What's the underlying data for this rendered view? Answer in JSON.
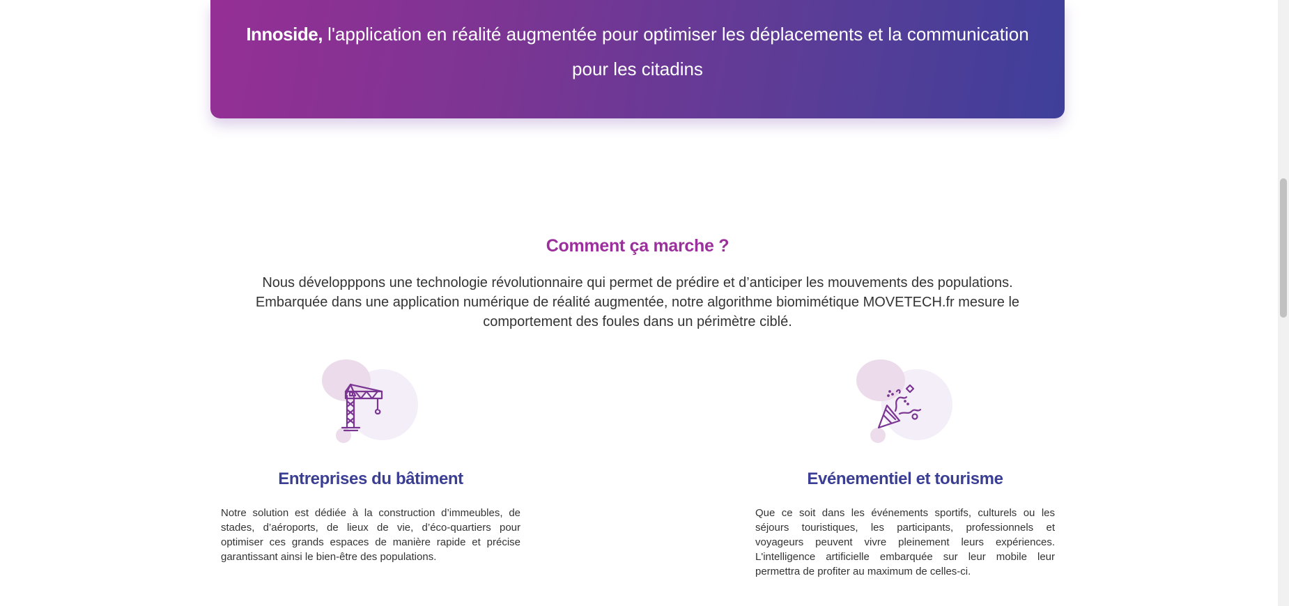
{
  "banner": {
    "brand": "Innoside,",
    "tagline": " l'application en réalité augmentée pour optimiser les déplacements et la communication pour les citadins"
  },
  "how_it_works": {
    "title": "Comment ça marche ?",
    "intro": "Nous développpons une technologie révolutionnaire qui permet de prédire et d’anticiper les mouvements des populations. Embarquée dans une application numérique de réalité augmentée, notre algorithme biomimétique MOVETECH.fr mesure le comportement des foules dans un périmètre ciblé."
  },
  "cards": [
    {
      "icon": "crane-icon",
      "title": "Entreprises du bâtiment",
      "text": "Notre solution est dédiée à la construction d’immeubles, de stades, d’aéroports, de lieux de vie, d’éco-quartiers pour optimiser ces grands espaces de manière rapide et précise garantissant ainsi le bien-être des populations."
    },
    {
      "icon": "party-popper-icon",
      "title": "Evénementiel et tourisme",
      "text": "Que ce soit dans les événements sportifs, culturels ou les séjours touristiques, les participants, professionnels et voyageurs peuvent vivre pleinement leurs expériences. L'intelligence artificielle embarquée sur leur mobile leur permettra de profiter au maximum de celles-ci."
    }
  ],
  "colors": {
    "banner_start": "#952f95",
    "banner_end": "#3e3f9a",
    "section_title": "#9b2f9b",
    "card_title": "#3b3f94",
    "icon_stroke": "#7a3592"
  }
}
